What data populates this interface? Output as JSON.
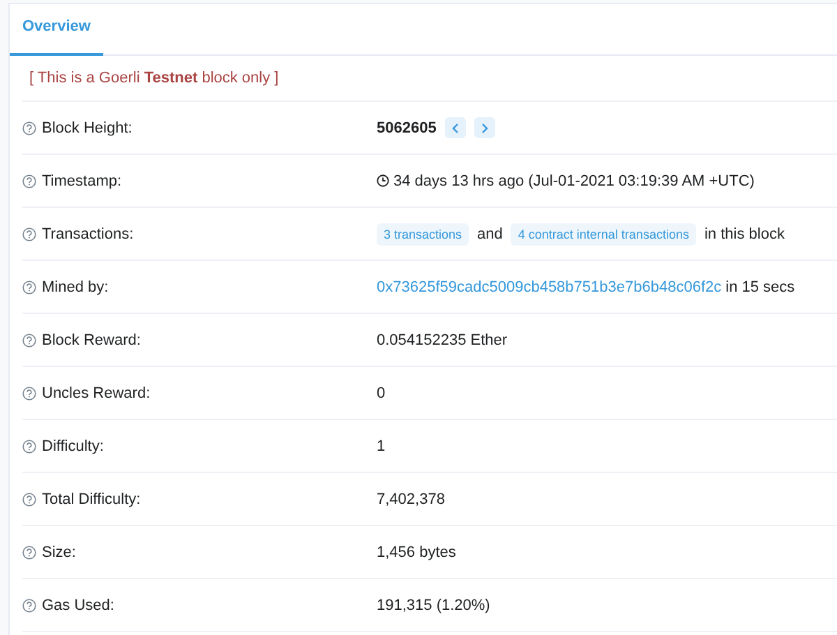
{
  "tabs": [
    {
      "label": "Overview",
      "selected": true
    }
  ],
  "notice": "[ This is a Goerli **Testnet** block only ]",
  "rows": [
    {
      "label": "Block Height:",
      "kind": "height",
      "value": "5062605"
    },
    {
      "label": "Timestamp:",
      "kind": "time",
      "value": "34 days 13 hrs ago (Jul-01-2021 03:19:39 AM +UTC)"
    },
    {
      "label": "Transactions:",
      "kind": "badges",
      "badges": [
        "3 transactions",
        "4 contract internal transactions"
      ],
      "joiner": "and",
      "suffix": "in this block"
    },
    {
      "label": "Mined by:",
      "kind": "link",
      "link": "0x73625f59cadc5009cb458b751b3e7b6b48c06f2c",
      "suffix": "in 15 secs"
    },
    {
      "label": "Block Reward:",
      "kind": "plain",
      "value": "0.054152235 Ether"
    },
    {
      "label": "Uncles Reward:",
      "kind": "plain",
      "value": "0"
    },
    {
      "label": "Difficulty:",
      "kind": "plain",
      "value": "1"
    },
    {
      "label": "Total Difficulty:",
      "kind": "plain",
      "value": "7,402,378"
    },
    {
      "label": "Size:",
      "kind": "plain",
      "value": "1,456 bytes"
    },
    {
      "label": "Gas Used:",
      "kind": "plain",
      "value": "191,315 (1.20%)"
    }
  ]
}
